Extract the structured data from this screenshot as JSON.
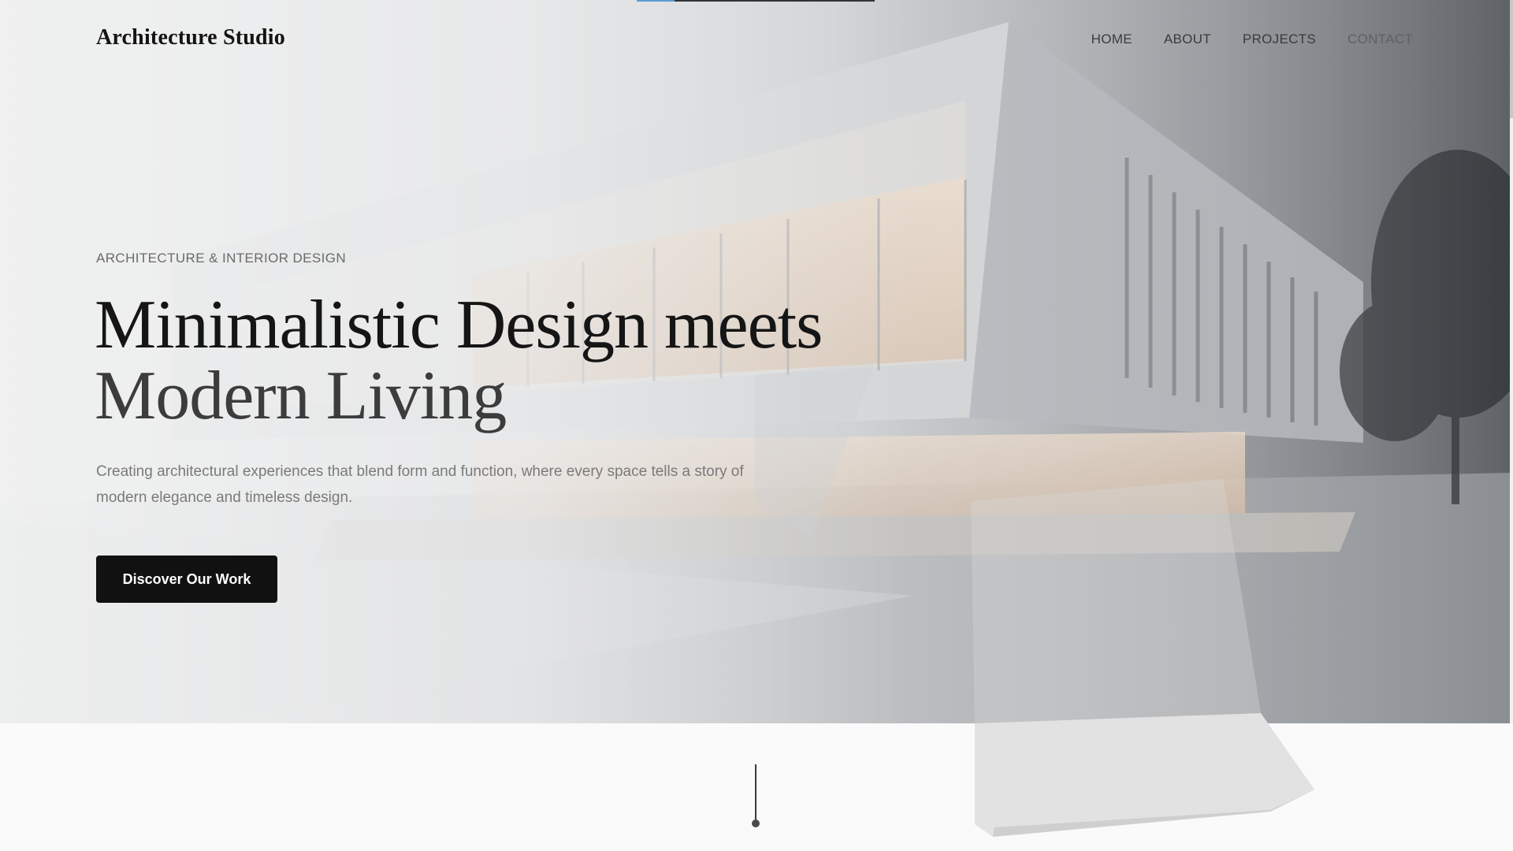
{
  "brand": {
    "name": "Architecture Studio"
  },
  "nav": {
    "items": [
      {
        "label": "HOME"
      },
      {
        "label": "ABOUT"
      },
      {
        "label": "PROJECTS"
      },
      {
        "label": "CONTACT"
      }
    ]
  },
  "hero": {
    "kicker": "ARCHITECTURE & INTERIOR DESIGN",
    "headline_line1": "Minimalistic Design meets",
    "headline_line2": "Modern Living",
    "subtitle": "Creating architectural experiences that blend form and function, where every space tells a story of modern elegance and timeless design.",
    "cta_label": "Discover Our Work",
    "image_description_icon": "building-photo"
  },
  "page_progress": {
    "value_fraction": 0.16
  },
  "colors": {
    "accent_dark": "#111111",
    "progress_fill": "#5b9bd5"
  },
  "icons": {
    "scroll_indicator": "scroll-down-indicator"
  }
}
